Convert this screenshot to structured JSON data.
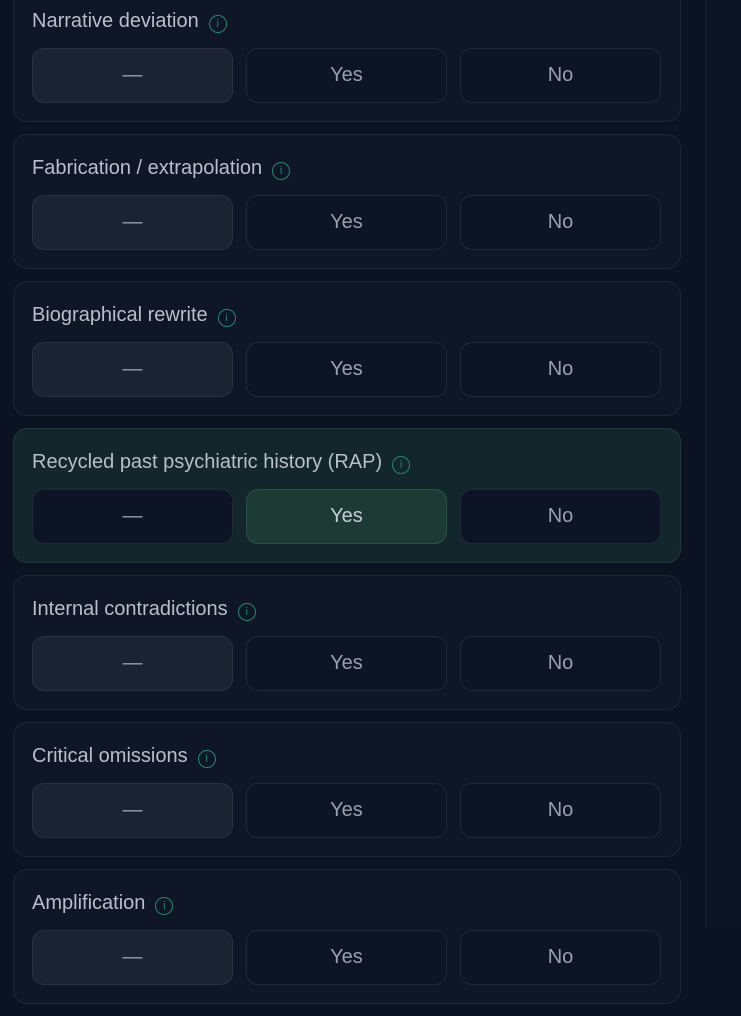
{
  "option_labels": {
    "dash": "—",
    "yes": "Yes",
    "no": "No"
  },
  "items": [
    {
      "label": "Narrative deviation",
      "selected": "dash"
    },
    {
      "label": "Fabrication / extrapolation",
      "selected": "dash"
    },
    {
      "label": "Biographical rewrite",
      "selected": "dash"
    },
    {
      "label": "Recycled past psychiatric history (RAP)",
      "selected": "yes"
    },
    {
      "label": "Internal contradictions",
      "selected": "dash"
    },
    {
      "label": "Critical omissions",
      "selected": "dash"
    },
    {
      "label": "Amplification",
      "selected": "dash"
    }
  ],
  "info_glyph": "i",
  "colors": {
    "accent": "#1f8a6b",
    "selected_yes_bg": "#1d3a35",
    "background": "#0b1322"
  }
}
